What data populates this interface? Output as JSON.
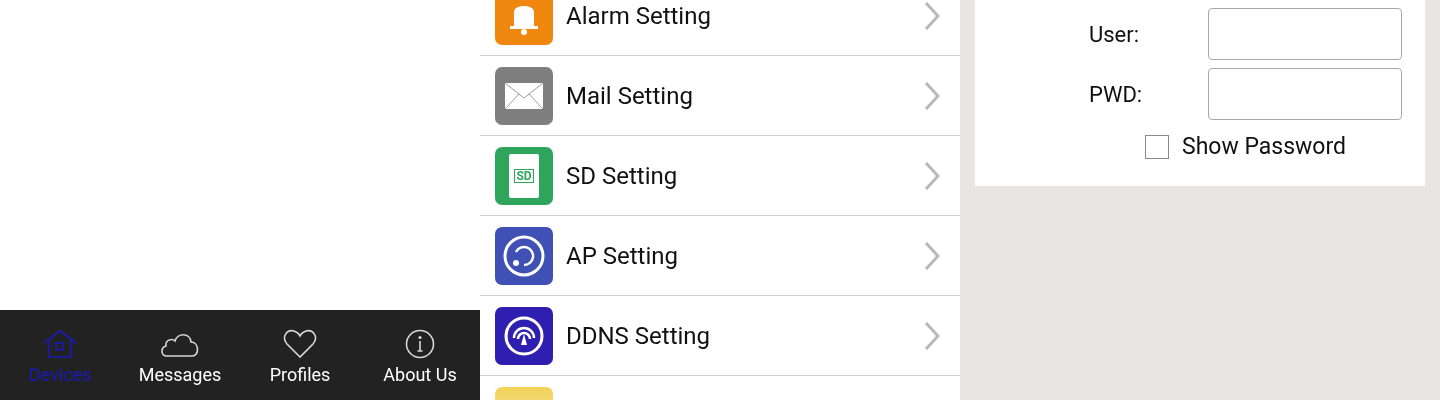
{
  "tab_bar": [
    {
      "label": "Devices",
      "kind": "house",
      "selected": true
    },
    {
      "label": "Messages",
      "kind": "cloud",
      "selected": false
    },
    {
      "label": "Profiles",
      "kind": "heart",
      "selected": false
    },
    {
      "label": "About Us",
      "kind": "info",
      "selected": false
    }
  ],
  "settings_list": [
    {
      "kind": "alarm",
      "label": "Alarm Setting"
    },
    {
      "kind": "mail",
      "label": "Mail Setting"
    },
    {
      "kind": "sd",
      "label": "SD Setting",
      "icon_text": "SD"
    },
    {
      "kind": "ap",
      "label": "AP Setting"
    },
    {
      "kind": "ddns",
      "label": "DDNS Setting"
    },
    {
      "kind": "yellow"
    }
  ],
  "login_form": {
    "fields": [
      {
        "label": "User:"
      },
      {
        "label": "PWD:"
      }
    ],
    "show_password": {
      "label": "Show Password",
      "checked": false
    }
  }
}
